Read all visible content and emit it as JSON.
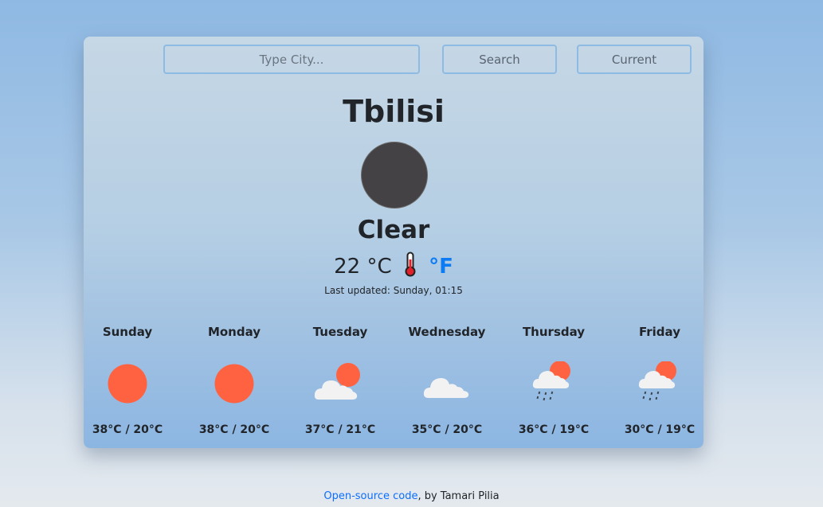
{
  "search": {
    "placeholder": "Type City...",
    "search_label": "Search",
    "current_label": "Current"
  },
  "current": {
    "city": "Tbilisi",
    "icon": "moon-clear-night-icon",
    "condition": "Clear",
    "temperature": "22",
    "unit_c": "°C",
    "unit_f": "°F",
    "updated": "Last updated: Sunday, 01:15"
  },
  "forecast": [
    {
      "day": "Sunday",
      "icon": "sun-icon",
      "range": "38°C / 20°C"
    },
    {
      "day": "Monday",
      "icon": "sun-icon",
      "range": "38°C / 20°C"
    },
    {
      "day": "Tuesday",
      "icon": "partly-cloudy-icon",
      "range": "37°C / 21°C"
    },
    {
      "day": "Wednesday",
      "icon": "cloud-icon",
      "range": "35°C / 20°C"
    },
    {
      "day": "Thursday",
      "icon": "rain-sun-icon",
      "range": "36°C / 19°C"
    },
    {
      "day": "Friday",
      "icon": "rain-sun-icon",
      "range": "30°C / 19°C"
    }
  ],
  "footer": {
    "link_text": "Open-source code",
    "by_text": ", by Tamari Pilia"
  },
  "colors": {
    "sun": "#ff6240",
    "cloud": "#f0f0f0",
    "moon": "#454246",
    "link": "#0d6efd",
    "accent_f": "#0d7cf2"
  }
}
